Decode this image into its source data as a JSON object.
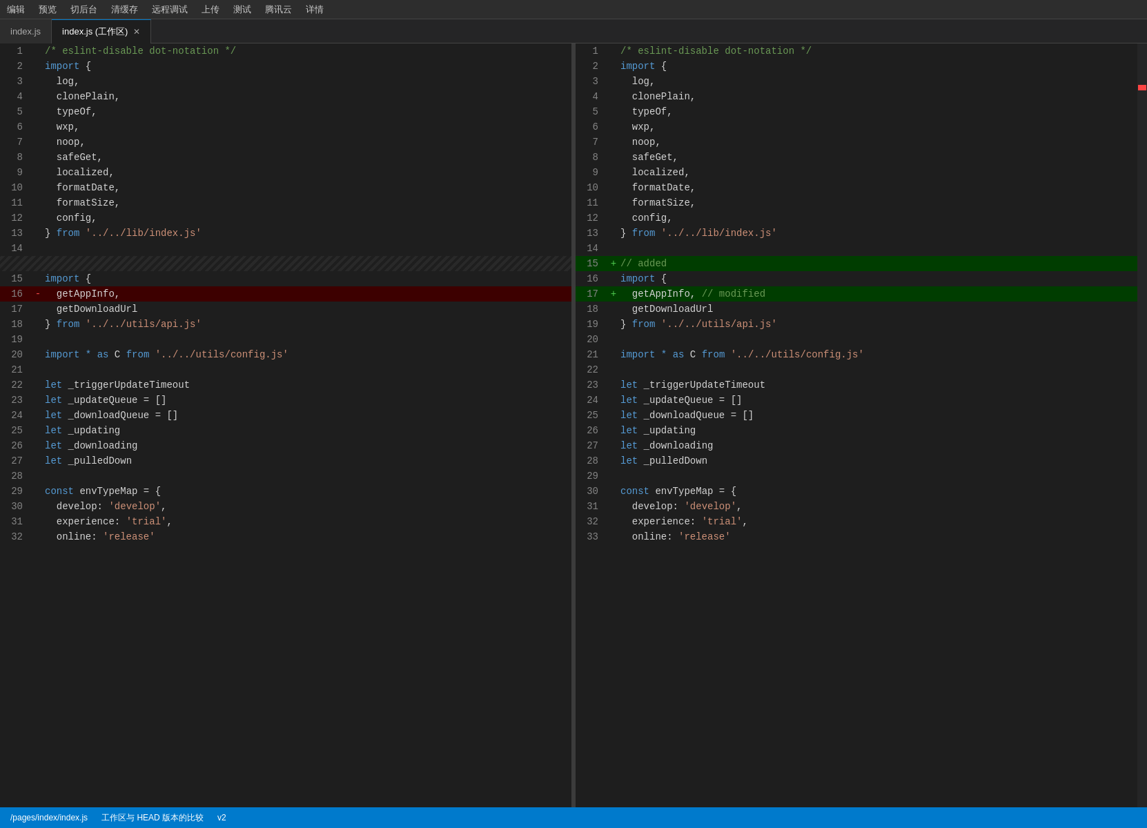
{
  "topMenu": {
    "items": [
      "编辑",
      "预览",
      "切后台",
      "清缓存",
      "远程调试",
      "上传",
      "测试",
      "腾讯云",
      "详情"
    ]
  },
  "tabs": [
    {
      "id": "tab1",
      "label": "index.js",
      "active": false,
      "closable": false
    },
    {
      "id": "tab2",
      "label": "index.js (工作区)",
      "active": true,
      "closable": true
    }
  ],
  "leftPane": {
    "title": "index.js",
    "lines": [
      {
        "num": 1,
        "marker": " ",
        "content": "/* eslint-disable dot-notation */"
      },
      {
        "num": 2,
        "marker": " ",
        "content": "import {"
      },
      {
        "num": 3,
        "marker": " ",
        "content": "  log,"
      },
      {
        "num": 4,
        "marker": " ",
        "content": "  clonePlain,"
      },
      {
        "num": 5,
        "marker": " ",
        "content": "  typeOf,"
      },
      {
        "num": 6,
        "marker": " ",
        "content": "  wxp,"
      },
      {
        "num": 7,
        "marker": " ",
        "content": "  noop,"
      },
      {
        "num": 8,
        "marker": " ",
        "content": "  safeGet,"
      },
      {
        "num": 9,
        "marker": " ",
        "content": "  localized,"
      },
      {
        "num": 10,
        "marker": " ",
        "content": "  formatDate,"
      },
      {
        "num": 11,
        "marker": " ",
        "content": "  formatSize,"
      },
      {
        "num": 12,
        "marker": " ",
        "content": "  config,"
      },
      {
        "num": 13,
        "marker": " ",
        "content": "} from '../../lib/index.js'"
      },
      {
        "num": 14,
        "marker": " ",
        "content": ""
      },
      {
        "num": null,
        "marker": " ",
        "content": "",
        "hatch": true
      },
      {
        "num": 15,
        "marker": " ",
        "content": "import {"
      },
      {
        "num": 16,
        "marker": "-",
        "content": "  getAppInfo,",
        "deleted": true
      },
      {
        "num": 17,
        "marker": " ",
        "content": "  getDownloadUrl"
      },
      {
        "num": 18,
        "marker": " ",
        "content": "} from '../../utils/api.js'"
      },
      {
        "num": 19,
        "marker": " ",
        "content": ""
      },
      {
        "num": 20,
        "marker": " ",
        "content": "import * as C from '../../utils/config.js'"
      },
      {
        "num": 21,
        "marker": " ",
        "content": ""
      },
      {
        "num": 22,
        "marker": " ",
        "content": "let _triggerUpdateTimeout"
      },
      {
        "num": 23,
        "marker": " ",
        "content": "let _updateQueue = []"
      },
      {
        "num": 24,
        "marker": " ",
        "content": "let _downloadQueue = []"
      },
      {
        "num": 25,
        "marker": " ",
        "content": "let _updating"
      },
      {
        "num": 26,
        "marker": " ",
        "content": "let _downloading"
      },
      {
        "num": 27,
        "marker": " ",
        "content": "let _pulledDown"
      },
      {
        "num": 28,
        "marker": " ",
        "content": ""
      },
      {
        "num": 29,
        "marker": " ",
        "content": "const envTypeMap = {"
      },
      {
        "num": 30,
        "marker": " ",
        "content": "  develop: 'develop',"
      },
      {
        "num": 31,
        "marker": " ",
        "content": "  experience: 'trial',"
      },
      {
        "num": 32,
        "marker": " ",
        "content": "  online: 'release'"
      }
    ]
  },
  "rightPane": {
    "title": "index.js (工作区)",
    "lines": [
      {
        "num": 1,
        "marker": " ",
        "content": "/* eslint-disable dot-notation */"
      },
      {
        "num": 2,
        "marker": " ",
        "content": "import {"
      },
      {
        "num": 3,
        "marker": " ",
        "content": "  log,"
      },
      {
        "num": 4,
        "marker": " ",
        "content": "  clonePlain,"
      },
      {
        "num": 5,
        "marker": " ",
        "content": "  typeOf,"
      },
      {
        "num": 6,
        "marker": " ",
        "content": "  wxp,"
      },
      {
        "num": 7,
        "marker": " ",
        "content": "  noop,"
      },
      {
        "num": 8,
        "marker": " ",
        "content": "  safeGet,"
      },
      {
        "num": 9,
        "marker": " ",
        "content": "  localized,"
      },
      {
        "num": 10,
        "marker": " ",
        "content": "  formatDate,"
      },
      {
        "num": 11,
        "marker": " ",
        "content": "  formatSize,"
      },
      {
        "num": 12,
        "marker": " ",
        "content": "  config,"
      },
      {
        "num": 13,
        "marker": " ",
        "content": "} from '../../lib/index.js'"
      },
      {
        "num": 14,
        "marker": " ",
        "content": ""
      },
      {
        "num": 15,
        "marker": "+",
        "content": "// added",
        "added": true
      },
      {
        "num": 16,
        "marker": " ",
        "content": "import {"
      },
      {
        "num": 17,
        "marker": "+",
        "content": "  getAppInfo, // modified",
        "added": true
      },
      {
        "num": 18,
        "marker": " ",
        "content": "  getDownloadUrl"
      },
      {
        "num": 19,
        "marker": " ",
        "content": "} from '../../utils/api.js'"
      },
      {
        "num": 20,
        "marker": " ",
        "content": ""
      },
      {
        "num": 21,
        "marker": " ",
        "content": "import * as C from '../../utils/config.js'"
      },
      {
        "num": 22,
        "marker": " ",
        "content": ""
      },
      {
        "num": 23,
        "marker": " ",
        "content": "let _triggerUpdateTimeout"
      },
      {
        "num": 24,
        "marker": " ",
        "content": "let _updateQueue = []"
      },
      {
        "num": 25,
        "marker": " ",
        "content": "let _downloadQueue = []"
      },
      {
        "num": 26,
        "marker": " ",
        "content": "let _updating"
      },
      {
        "num": 27,
        "marker": " ",
        "content": "let _downloading"
      },
      {
        "num": 28,
        "marker": " ",
        "content": "let _pulledDown"
      },
      {
        "num": 29,
        "marker": " ",
        "content": ""
      },
      {
        "num": 30,
        "marker": " ",
        "content": "const envTypeMap = {"
      },
      {
        "num": 31,
        "marker": " ",
        "content": "  develop: 'develop',"
      },
      {
        "num": 32,
        "marker": " ",
        "content": "  experience: 'trial',"
      },
      {
        "num": 33,
        "marker": " ",
        "content": "  online: 'release'"
      }
    ]
  },
  "statusBar": {
    "path": "/pages/index/index.js",
    "label": "工作区与 HEAD 版本的比较",
    "version": "v2"
  }
}
